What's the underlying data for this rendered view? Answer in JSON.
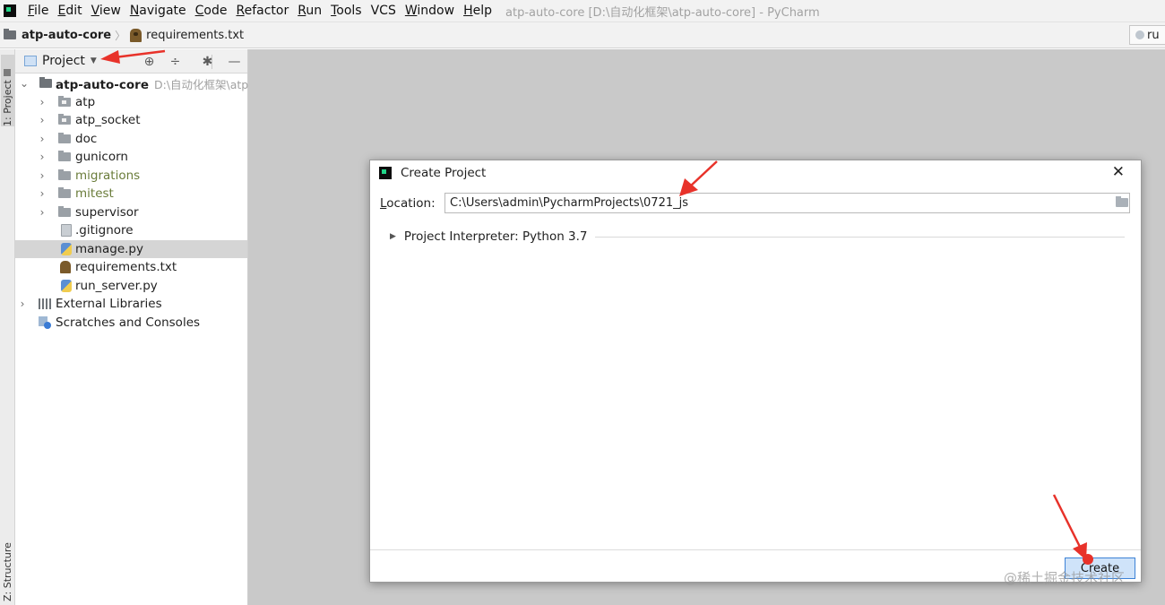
{
  "menubar": {
    "items": [
      {
        "mnemonic": "F",
        "rest": "ile"
      },
      {
        "mnemonic": "E",
        "rest": "dit"
      },
      {
        "mnemonic": "V",
        "rest": "iew"
      },
      {
        "mnemonic": "N",
        "rest": "avigate"
      },
      {
        "mnemonic": "C",
        "rest": "ode"
      },
      {
        "mnemonic": "R",
        "rest": "efactor"
      },
      {
        "mnemonic": "R",
        "rest": "un"
      },
      {
        "mnemonic": "T",
        "rest": "ools"
      },
      {
        "mnemonic": "",
        "rest": "VCS"
      },
      {
        "mnemonic": "W",
        "rest": "indow"
      },
      {
        "mnemonic": "H",
        "rest": "elp"
      }
    ],
    "window_title": "atp-auto-core [D:\\自动化框架\\atp-auto-core] - PyCharm"
  },
  "navbar": {
    "root": "atp-auto-core",
    "file": "requirements.txt",
    "run_label": "ru"
  },
  "side_tabs": {
    "project": "1: Project",
    "structure": "Z: Structure"
  },
  "project_panel": {
    "title": "Project",
    "root": {
      "name": "atp-auto-core",
      "path_hint": "D:\\自动化框架\\atp"
    },
    "nodes": [
      {
        "name": "atp"
      },
      {
        "name": "atp_socket"
      },
      {
        "name": "doc"
      },
      {
        "name": "gunicorn"
      },
      {
        "name": "migrations"
      },
      {
        "name": "mitest"
      },
      {
        "name": "supervisor"
      },
      {
        "name": ".gitignore"
      },
      {
        "name": "manage.py"
      },
      {
        "name": "requirements.txt"
      },
      {
        "name": "run_server.py"
      }
    ],
    "external_libraries": "External Libraries",
    "scratches": "Scratches and Consoles"
  },
  "dialog": {
    "title": "Create Project",
    "location_label": {
      "mnemonic": "L",
      "rest": "ocation:"
    },
    "location_value": "C:\\Users\\admin\\PycharmProjects\\0721_js",
    "interpreter_label": "Project Interpreter: Python 3.7",
    "create_button": "Create"
  },
  "watermark": "@稀土掘金技术社区",
  "colors": {
    "annotation_arrow": "#e8322a",
    "editor_background": "#c9c9c9",
    "selection": "#d5d5d5",
    "primary_button": "#cfe3f9"
  }
}
